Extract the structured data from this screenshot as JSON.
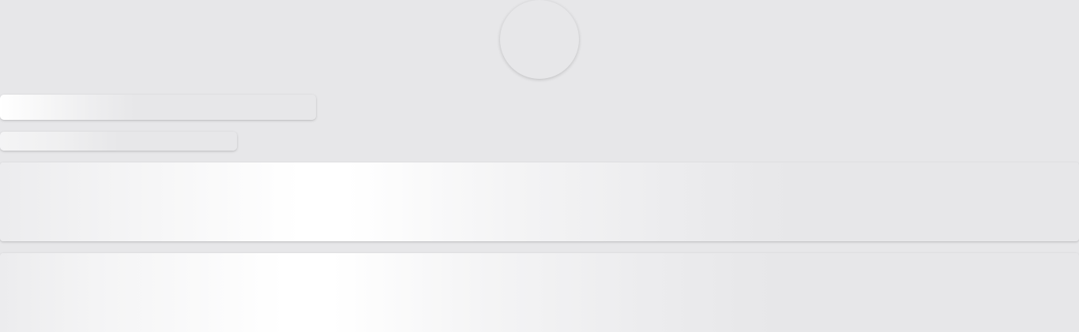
{
  "page": {
    "state": "loading-skeleton",
    "background_color": "#e7e7e9",
    "shimmer_highlight_color": "#ffffff"
  },
  "skeleton": {
    "placeholders": [
      {
        "name": "avatar-placeholder",
        "shape": "circle"
      },
      {
        "name": "title-line-placeholder",
        "shape": "rounded-rect"
      },
      {
        "name": "subtitle-line-placeholder",
        "shape": "rounded-rect"
      },
      {
        "name": "content-block-placeholder",
        "shape": "rounded-rect"
      },
      {
        "name": "content-block-placeholder",
        "shape": "rounded-rect"
      }
    ]
  }
}
